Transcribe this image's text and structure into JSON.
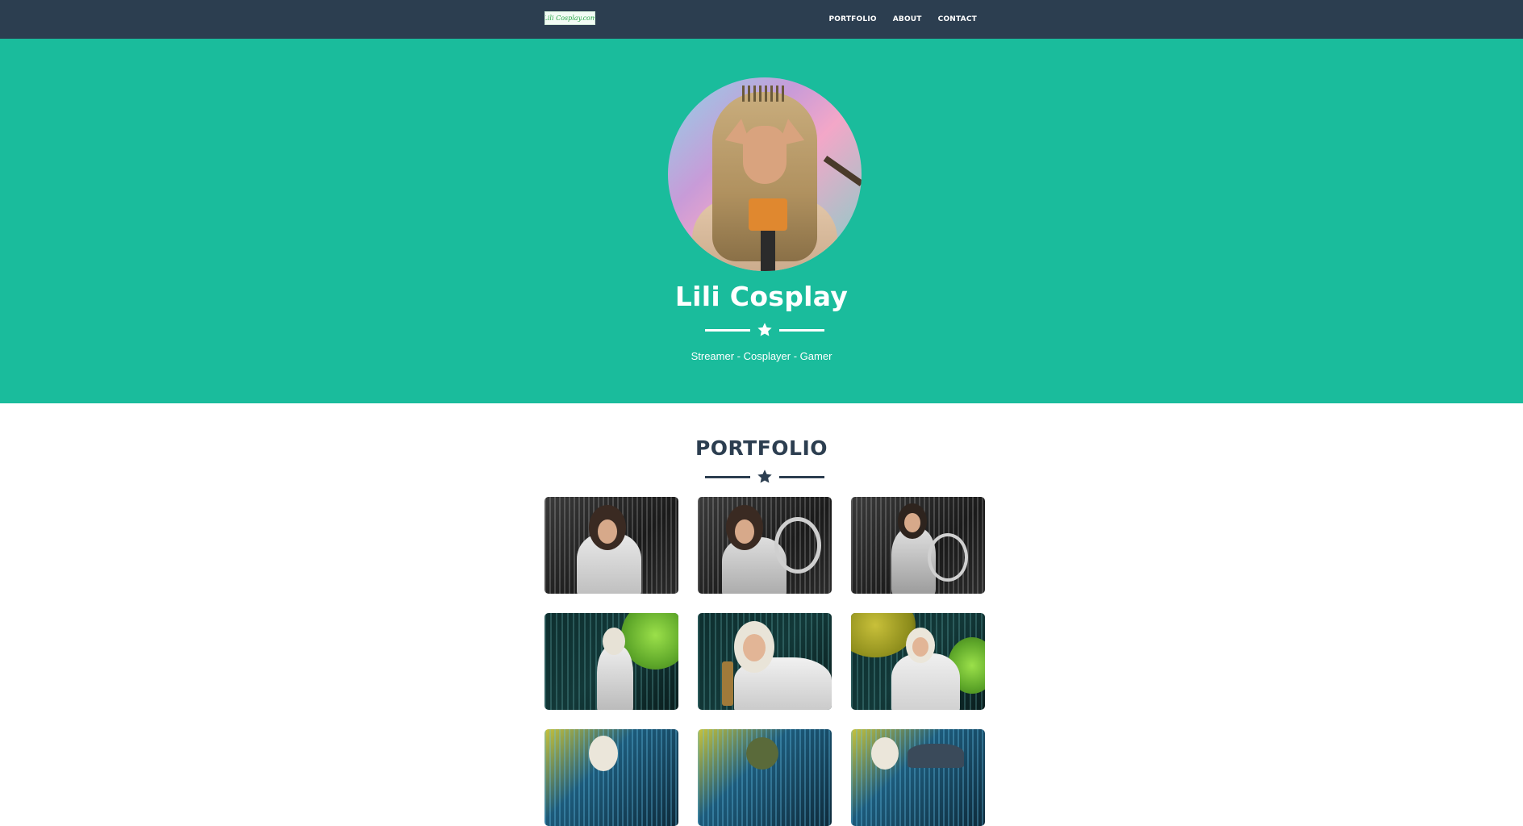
{
  "navbar": {
    "brand": "Lili Cosplay.com",
    "links": [
      "PORTFOLIO",
      "ABOUT",
      "CONTACT"
    ]
  },
  "hero": {
    "title": "Lili Cosplay",
    "subtitle": "Streamer - Cosplayer - Gamer"
  },
  "portfolio": {
    "title": "PORTFOLIO"
  },
  "colors": {
    "navbar": "#2c3e50",
    "hero": "#1abc9c",
    "heading": "#2c3e50"
  },
  "icons": {
    "divider": "star-icon"
  }
}
